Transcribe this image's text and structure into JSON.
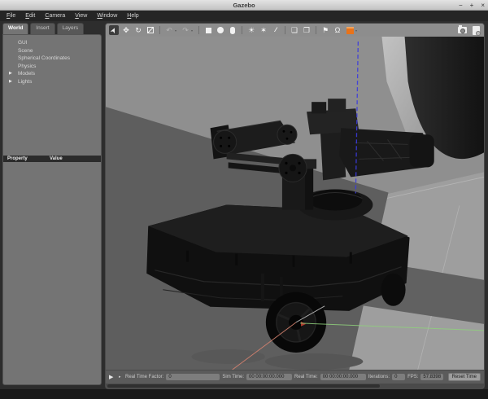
{
  "window": {
    "title": "Gazebo",
    "controls": {
      "minimize": "−",
      "maximize": "+",
      "close": "×"
    }
  },
  "menu": {
    "items": [
      "File",
      "Edit",
      "Camera",
      "View",
      "Window",
      "Help"
    ]
  },
  "left_panel": {
    "tabs": [
      {
        "label": "World",
        "active": true
      },
      {
        "label": "Insert",
        "active": false
      },
      {
        "label": "Layers",
        "active": false
      }
    ],
    "tree": [
      {
        "label": "GUI",
        "expandable": false
      },
      {
        "label": "Scene",
        "expandable": false
      },
      {
        "label": "Spherical Coordinates",
        "expandable": false
      },
      {
        "label": "Physics",
        "expandable": false
      },
      {
        "label": "Models",
        "expandable": true
      },
      {
        "label": "Lights",
        "expandable": true
      }
    ],
    "expand_arrow": "▶",
    "property_table": {
      "columns": [
        "Property",
        "Value"
      ],
      "rows": []
    }
  },
  "toolbar": {
    "accent_color": "#e8731a",
    "glyphs": {
      "select": "➤",
      "translate": "✥",
      "rotate": "↻",
      "undo": "↶",
      "redo": "↷",
      "dropdown": "▾",
      "sun": "☀",
      "point_light": "✶",
      "directional": "∕∕",
      "copy": "❏",
      "paste": "❐",
      "align": "⚑",
      "snap": "Ω"
    }
  },
  "scene": {
    "joint_axis_color": "#3b3bdf",
    "axis_x_color": "#d5826f",
    "axis_y_color": "#8fd07c",
    "content": "dark mobile robot with manipulator arm on gray ground plane"
  },
  "statusbar": {
    "play": "▶",
    "step": "▸",
    "fields": [
      {
        "label": "Real Time Factor:",
        "value": "0"
      },
      {
        "label": "Sim Time:",
        "value": "00 00:00:00.000"
      },
      {
        "label": "Real Time:",
        "value": "00 00:00:00.000"
      },
      {
        "label": "Iterations:",
        "value": "0"
      },
      {
        "label": "FPS:",
        "value": "57.8398"
      }
    ],
    "reset_button": "Reset Time"
  }
}
